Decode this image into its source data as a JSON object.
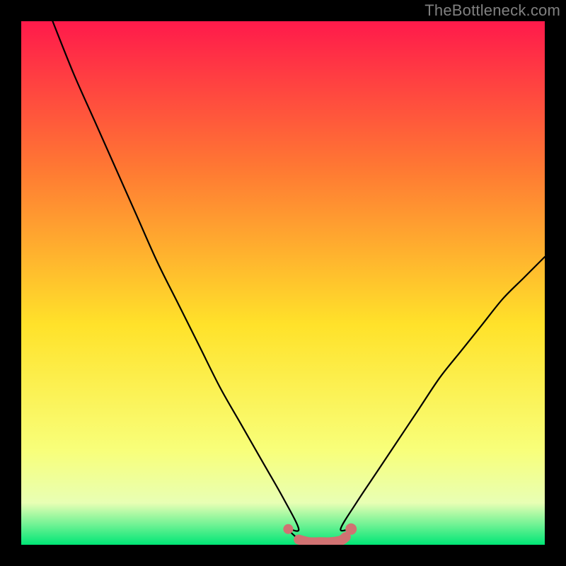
{
  "watermark": "TheBottleneck.com",
  "colors": {
    "frame": "#000000",
    "curve": "#000000",
    "marker": "#d17272",
    "gradient_top": "#ff1a4b",
    "gradient_upper": "#ff7833",
    "gradient_mid": "#ffe22a",
    "gradient_low": "#f8ff7a",
    "gradient_pale": "#e8ffb4",
    "gradient_bottom": "#00e676"
  },
  "chart_data": {
    "type": "line",
    "title": "",
    "xlabel": "",
    "ylabel": "",
    "xlim": [
      0,
      100
    ],
    "ylim": [
      0,
      100
    ],
    "series": [
      {
        "name": "left-branch",
        "x": [
          6,
          10,
          14,
          18,
          22,
          26,
          30,
          34,
          38,
          42,
          46,
          50,
          53
        ],
        "values": [
          100,
          90,
          81,
          72,
          63,
          54,
          46,
          38,
          30,
          23,
          16,
          9,
          3
        ]
      },
      {
        "name": "right-branch",
        "x": [
          61,
          64,
          68,
          72,
          76,
          80,
          84,
          88,
          92,
          96,
          100
        ],
        "values": [
          3,
          8,
          14,
          20,
          26,
          32,
          37,
          42,
          47,
          51,
          55
        ]
      },
      {
        "name": "valley-floor",
        "x": [
          51,
          53,
          55,
          57,
          59,
          61,
          62,
          63
        ],
        "values": [
          3,
          1,
          0.5,
          0.5,
          0.5,
          0.8,
          1.5,
          3
        ]
      }
    ],
    "markers": {
      "name": "highlighted-region",
      "x": [
        51,
        53,
        55,
        57,
        59,
        61,
        62,
        63
      ],
      "values": [
        3,
        1,
        0.5,
        0.5,
        0.5,
        0.8,
        1.5,
        3
      ]
    }
  }
}
